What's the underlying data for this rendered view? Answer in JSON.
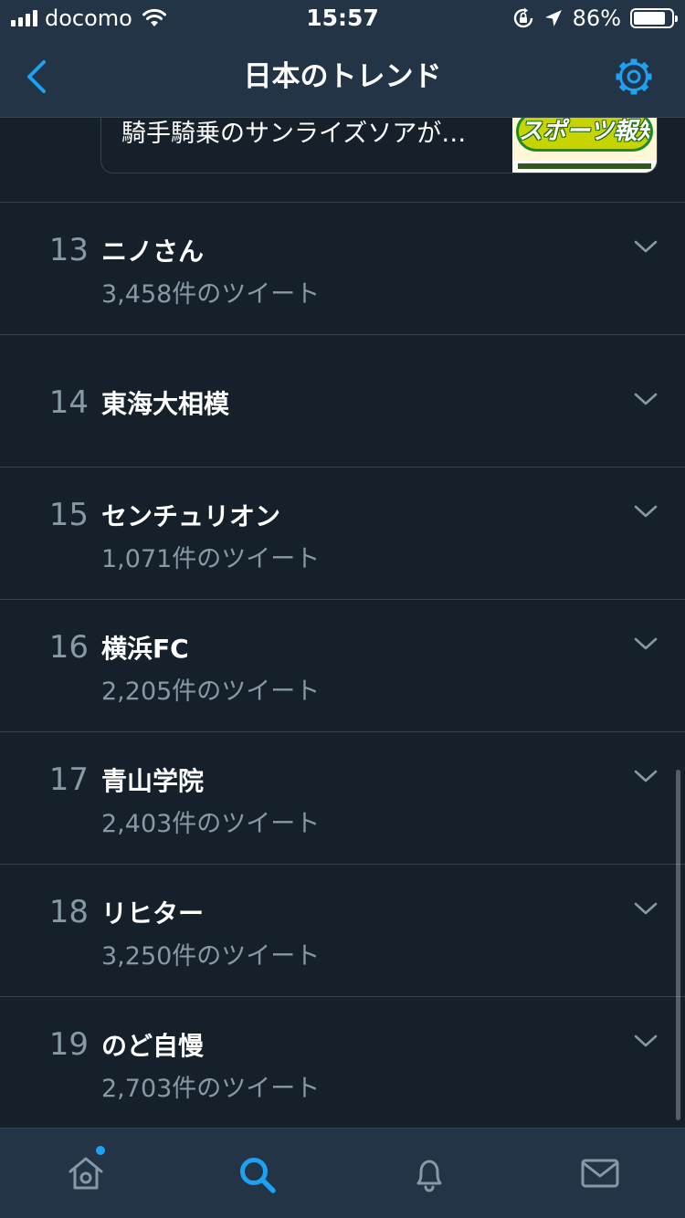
{
  "status_bar": {
    "carrier": "docomo",
    "time": "15:57",
    "battery_percent": "86%",
    "battery_level": 0.86
  },
  "header": {
    "title": "日本のトレンド"
  },
  "news_card": {
    "text": "騎手騎乗のサンライズソアが…",
    "thumb_text": "スポーツ報知"
  },
  "trends": [
    {
      "rank": "13",
      "name": "ニノさん",
      "count": "3,458件のツイート"
    },
    {
      "rank": "14",
      "name": "東海大相模",
      "count": ""
    },
    {
      "rank": "15",
      "name": "センチュリオン",
      "count": "1,071件のツイート"
    },
    {
      "rank": "16",
      "name": "横浜FC",
      "count": "2,205件のツイート"
    },
    {
      "rank": "17",
      "name": "青山学院",
      "count": "2,403件のツイート"
    },
    {
      "rank": "18",
      "name": "リヒター",
      "count": "3,250件のツイート"
    },
    {
      "rank": "19",
      "name": "のど自慢",
      "count": "2,703件のツイート"
    }
  ],
  "tab_bar": {
    "tabs": [
      "home-icon",
      "search-icon",
      "bell-icon",
      "mail-icon"
    ],
    "active": "search-icon"
  },
  "colors": {
    "background": "#15202b",
    "bar": "#243447",
    "accent": "#1da1f2",
    "secondary_text": "#8899a6",
    "divider": "#38444d"
  }
}
